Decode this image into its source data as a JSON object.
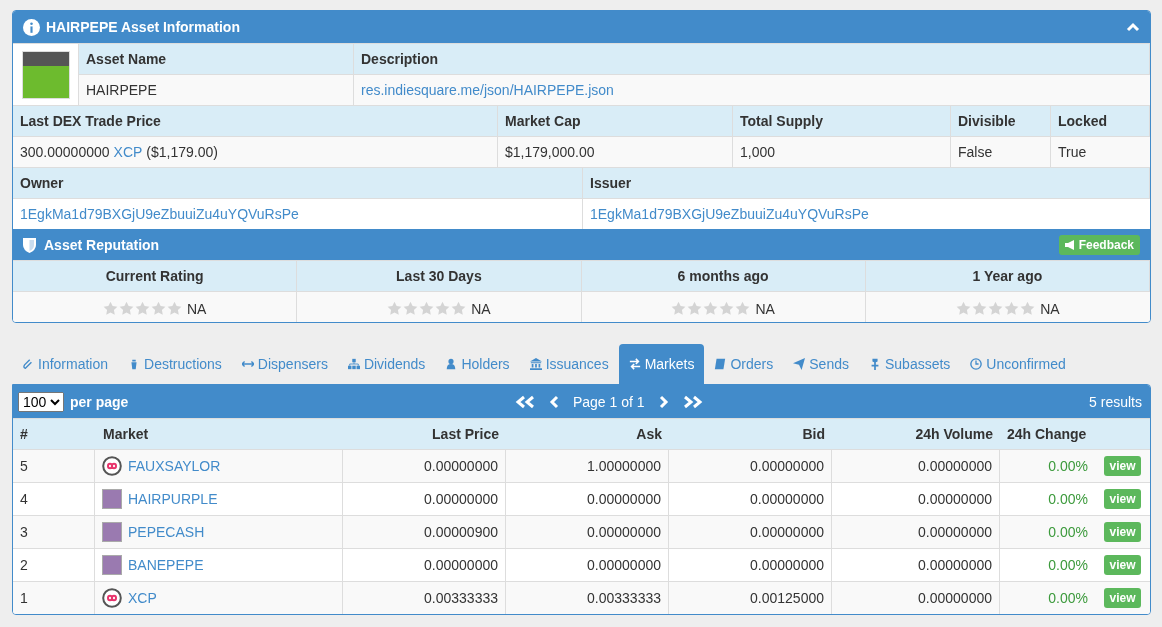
{
  "asset_panel": {
    "title": "HAIRPEPE Asset Information",
    "asset_name_label": "Asset Name",
    "description_label": "Description",
    "asset_name": "HAIRPEPE",
    "description": "res.indiesquare.me/json/HAIRPEPE.json",
    "price_label": "Last DEX Trade Price",
    "market_cap_label": "Market Cap",
    "total_supply_label": "Total Supply",
    "divisible_label": "Divisible",
    "locked_label": "Locked",
    "price": "300.00000000",
    "price_unit": "XCP",
    "price_usd": "($1,179.00)",
    "market_cap": "$1,179,000.00",
    "total_supply": "1,000",
    "divisible": "False",
    "locked": "True",
    "owner_label": "Owner",
    "issuer_label": "Issuer",
    "owner": "1EgkMa1d79BXGjU9eZbuuiZu4uYQVuRsPe",
    "issuer": "1EgkMa1d79BXGjU9eZbuuiZu4uYQVuRsPe"
  },
  "reputation": {
    "title": "Asset Reputation",
    "feedback_button": "Feedback",
    "ratings": [
      {
        "label": "Current Rating",
        "stars": 0,
        "value": "NA"
      },
      {
        "label": "Last 30 Days",
        "stars": 0,
        "value": "NA"
      },
      {
        "label": "6 months ago",
        "stars": 0,
        "value": "NA"
      },
      {
        "label": "1 Year ago",
        "stars": 0,
        "value": "NA"
      }
    ]
  },
  "tabs": [
    {
      "label": "Information",
      "selected": false
    },
    {
      "label": "Destructions",
      "selected": false
    },
    {
      "label": "Dispensers",
      "selected": false
    },
    {
      "label": "Dividends",
      "selected": false
    },
    {
      "label": "Holders",
      "selected": false
    },
    {
      "label": "Issuances",
      "selected": false
    },
    {
      "label": "Markets",
      "selected": true
    },
    {
      "label": "Orders",
      "selected": false
    },
    {
      "label": "Sends",
      "selected": false
    },
    {
      "label": "Subassets",
      "selected": false
    },
    {
      "label": "Unconfirmed",
      "selected": false
    }
  ],
  "markets": {
    "per_page_value": "100",
    "per_page_label": "per page",
    "page_text": "Page 1 of 1",
    "results": "5 results",
    "columns": [
      "#",
      "Market",
      "Last Price",
      "Ask",
      "Bid",
      "24h Volume",
      "24h Change"
    ],
    "rows": [
      {
        "index": "5",
        "kind": "logo",
        "market": "FAUXSAYLOR",
        "last_price": "0.00000000",
        "ask": "1.00000000",
        "bid": "0.00000000",
        "volume": "0.00000000",
        "change": "0.00%",
        "action": "view"
      },
      {
        "index": "4",
        "kind": "image",
        "market": "HAIRPURPLE",
        "last_price": "0.00000000",
        "ask": "0.00000000",
        "bid": "0.00000000",
        "volume": "0.00000000",
        "change": "0.00%",
        "action": "view"
      },
      {
        "index": "3",
        "kind": "image",
        "market": "PEPECASH",
        "last_price": "0.00000900",
        "ask": "0.00000000",
        "bid": "0.00000000",
        "volume": "0.00000000",
        "change": "0.00%",
        "action": "view"
      },
      {
        "index": "2",
        "kind": "image",
        "market": "BANEPEPE",
        "last_price": "0.00000000",
        "ask": "0.00000000",
        "bid": "0.00000000",
        "volume": "0.00000000",
        "change": "0.00%",
        "action": "view"
      },
      {
        "index": "1",
        "kind": "logo",
        "market": "XCP",
        "last_price": "0.00333333",
        "ask": "0.00333333",
        "bid": "0.00125000",
        "volume": "0.00000000",
        "change": "0.00%",
        "action": "view"
      }
    ]
  }
}
